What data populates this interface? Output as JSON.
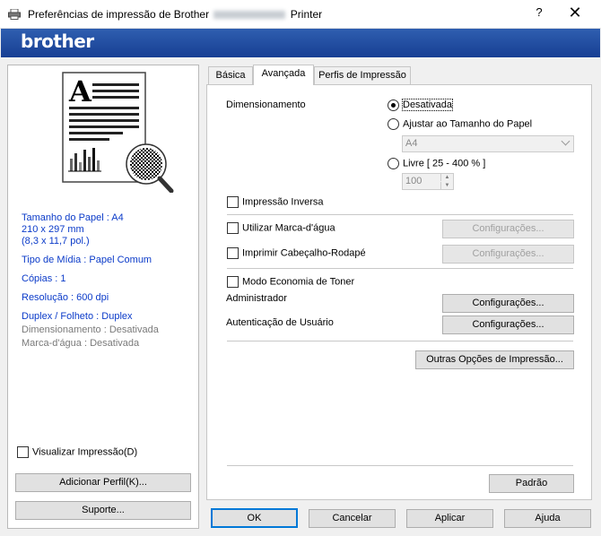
{
  "window": {
    "title_prefix": "Preferências de impressão de Brother",
    "title_suffix": "Printer",
    "help_label": "?",
    "close_label": "✕"
  },
  "brand": {
    "logo": "brother",
    "bar_color": "#1f4ea3"
  },
  "left": {
    "info_blue": [
      "Tamanho do Papel : A4",
      "210 x 297 mm",
      "(8,3 x 11,7 pol.)",
      "Tipo de Mídia : Papel Comum",
      "Cópias : 1",
      "Resolução : 600 dpi",
      "Duplex / Folheto : Duplex"
    ],
    "info_gray": [
      "Dimensionamento : Desativada",
      "Marca-d'água : Desativada"
    ],
    "preview_checkbox": "Visualizar Impressão(D)",
    "add_profile_button": "Adicionar Perfil(K)...",
    "support_button": "Suporte..."
  },
  "tabs": [
    {
      "label": "Básica",
      "active": false
    },
    {
      "label": "Avançada",
      "active": true
    },
    {
      "label": "Perfis de Impressão",
      "active": false
    }
  ],
  "advanced": {
    "scaling_label": "Dimensionamento",
    "scaling_off": "Desativada",
    "scaling_fit": "Ajustar ao Tamanho do Papel",
    "paper_size_value": "A4",
    "scaling_free": "Livre [ 25 - 400 % ]",
    "free_value": "100",
    "reverse_print": "Impressão Inversa",
    "watermark": "Utilizar Marca-d'água",
    "header_footer": "Imprimir Cabeçalho-Rodapé",
    "toner_save": "Modo Economia de Toner",
    "administrator": "Administrador",
    "user_auth": "Autenticação de Usuário",
    "settings_button": "Configurações...",
    "other_options_button": "Outras Opções de Impressão...",
    "default_button": "Padrão"
  },
  "footer": {
    "ok": "OK",
    "cancel": "Cancelar",
    "apply": "Aplicar",
    "help": "Ajuda"
  },
  "icons": {
    "printer": "printer-icon",
    "doc_preview": "document-preview-icon"
  }
}
